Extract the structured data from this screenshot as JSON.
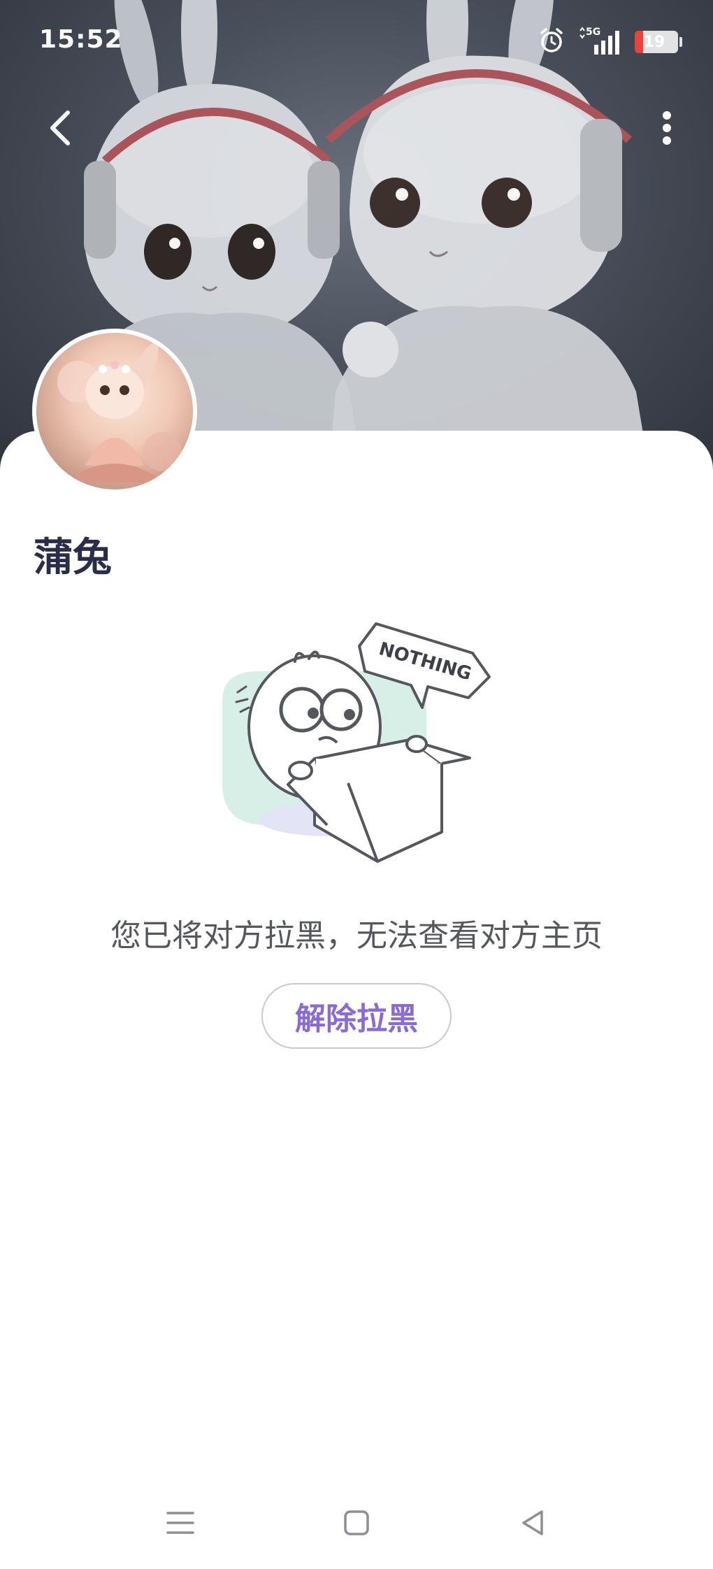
{
  "status_bar": {
    "time": "15:52",
    "network": "5G",
    "battery_level": "19",
    "battery_fraction": 0.19
  },
  "profile": {
    "nickname": "蒲兔"
  },
  "illustration": {
    "speech_text": "NOTHING"
  },
  "blocked_state": {
    "message": "您已将对方拉黑，无法查看对方主页",
    "unblock_label": "解除拉黑"
  },
  "colors": {
    "accent": "#8a6ad6",
    "title": "#2a2d4a",
    "message": "#55575f",
    "battery_low": "#e5453b"
  },
  "icons": {
    "back": "chevron-left-icon",
    "more": "more-vertical-icon",
    "alarm": "alarm-icon",
    "signal": "signal-icon",
    "battery": "battery-icon",
    "nav_menu": "menu-icon",
    "nav_home": "square-home-icon",
    "nav_back": "triangle-back-icon"
  }
}
